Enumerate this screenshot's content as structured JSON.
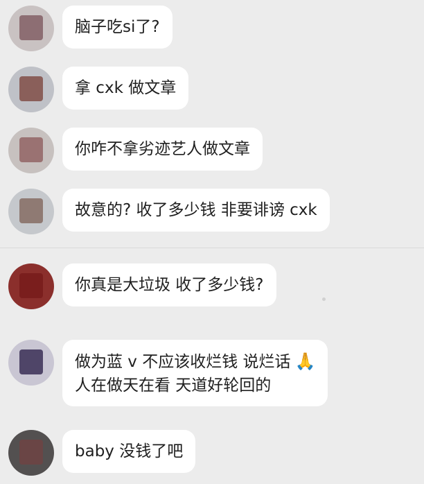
{
  "messages": [
    {
      "avatar_bg": "#c9c2c2",
      "avatar_fg": "#8d6e73",
      "text": "脑子吃si了?"
    },
    {
      "avatar_bg": "#bfc1c7",
      "avatar_fg": "#8a5f5a",
      "text": "拿 cxk 做文章"
    },
    {
      "avatar_bg": "#c7c1bf",
      "avatar_fg": "#9a7272",
      "text": "你咋不拿劣迹艺人做文章"
    },
    {
      "avatar_bg": "#c5c8cc",
      "avatar_fg": "#8f7a73",
      "text": "故意的? 收了多少钱 非要诽谤 cxk"
    },
    {
      "avatar_bg": "#8b2f2c",
      "avatar_fg": "#7a1e1d",
      "text": "你真是大垃圾 收了多少钱?"
    },
    {
      "avatar_bg": "#c9c6d3",
      "avatar_fg": "#4f4568",
      "lines": [
        "做为蓝 v 不应该收烂钱 说烂话",
        "人在做天在看 天道好轮回的"
      ],
      "emoji": "🙏"
    },
    {
      "avatar_bg": "#535050",
      "avatar_fg": "#6a4545",
      "text": "baby 没钱了吧"
    }
  ]
}
